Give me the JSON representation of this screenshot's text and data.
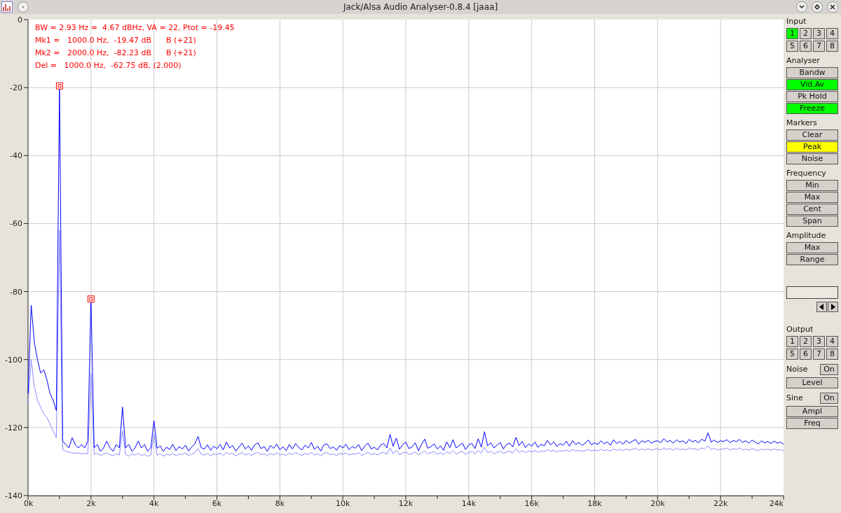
{
  "window": {
    "title": "Jack/Alsa Audio Analyser-0.8.4  [jaaa]"
  },
  "plot": {
    "readout": [
      "BW = 2.93 Hz =  4.67 dBHz, VA = 22, Ptot = -19.45",
      "Mk1 =   1000.0 Hz,  -19.47 dB      B (+21)",
      "Mk2 =   2000.0 Hz,  -82.23 dB      B (+21)",
      "Del =   1000.0 Hz,  -62.75 dB, (2.000)"
    ],
    "chart_data": {
      "type": "line",
      "grid": true,
      "xlim": [
        0,
        24000
      ],
      "ylim": [
        -140,
        0
      ],
      "xticks": [
        {
          "value": 0,
          "label": "0k"
        },
        {
          "value": 2000,
          "label": "2k"
        },
        {
          "value": 4000,
          "label": "4k"
        },
        {
          "value": 6000,
          "label": "6k"
        },
        {
          "value": 8000,
          "label": "8k"
        },
        {
          "value": 10000,
          "label": "10k"
        },
        {
          "value": 12000,
          "label": "12k"
        },
        {
          "value": 14000,
          "label": "14k"
        },
        {
          "value": 16000,
          "label": "16k"
        },
        {
          "value": 18000,
          "label": "18k"
        },
        {
          "value": 20000,
          "label": "20k"
        },
        {
          "value": 22000,
          "label": "22k"
        },
        {
          "value": 24000,
          "label": "24k"
        }
      ],
      "yticks": [
        0,
        -20,
        -40,
        -60,
        -80,
        -100,
        -120,
        -140
      ],
      "x": [
        0,
        100,
        200,
        300,
        400,
        500,
        600,
        700,
        800,
        900,
        1000,
        1100,
        1200,
        1300,
        1400,
        1500,
        1600,
        1700,
        1800,
        1900,
        2000,
        2100,
        2200,
        2300,
        2400,
        2500,
        2600,
        2700,
        2800,
        2900,
        3000,
        3100,
        3200,
        3300,
        3400,
        3500,
        3600,
        3700,
        3800,
        3900,
        4000,
        4100,
        4200,
        4300,
        4400,
        4500,
        4600,
        4700,
        4800,
        4900,
        5000,
        5100,
        5200,
        5300,
        5400,
        5500,
        5600,
        5700,
        5800,
        5900,
        6000,
        6100,
        6200,
        6300,
        6400,
        6500,
        6600,
        6700,
        6800,
        6900,
        7000,
        7100,
        7200,
        7300,
        7400,
        7500,
        7600,
        7700,
        7800,
        7900,
        8000,
        8100,
        8200,
        8300,
        8400,
        8500,
        8600,
        8700,
        8800,
        8900,
        9000,
        9100,
        9200,
        9300,
        9400,
        9500,
        9600,
        9700,
        9800,
        9900,
        10000,
        10100,
        10200,
        10300,
        10400,
        10500,
        10600,
        10700,
        10800,
        10900,
        11000,
        11100,
        11200,
        11300,
        11400,
        11500,
        11600,
        11700,
        11800,
        11900,
        12000,
        12100,
        12200,
        12300,
        12400,
        12500,
        12600,
        12700,
        12800,
        12900,
        13000,
        13100,
        13200,
        13300,
        13400,
        13500,
        13600,
        13700,
        13800,
        13900,
        14000,
        14100,
        14200,
        14300,
        14400,
        14500,
        14600,
        14700,
        14800,
        14900,
        15000,
        15100,
        15200,
        15300,
        15400,
        15500,
        15600,
        15700,
        15800,
        15900,
        16000,
        16100,
        16200,
        16300,
        16400,
        16500,
        16600,
        16700,
        16800,
        16900,
        17000,
        17100,
        17200,
        17300,
        17400,
        17500,
        17600,
        17700,
        17800,
        17900,
        18000,
        18100,
        18200,
        18300,
        18400,
        18500,
        18600,
        18700,
        18800,
        18900,
        19000,
        19100,
        19200,
        19300,
        19400,
        19500,
        19600,
        19700,
        19800,
        19900,
        20000,
        20100,
        20200,
        20300,
        20400,
        20500,
        20600,
        20700,
        20800,
        20900,
        21000,
        21100,
        21200,
        21300,
        21400,
        21500,
        21600,
        21700,
        21800,
        21900,
        22000,
        22100,
        22200,
        22300,
        22400,
        22500,
        22600,
        22700,
        22800,
        22900,
        23000,
        23100,
        23200,
        23300,
        23400,
        23500,
        23600,
        23700,
        23800,
        23900,
        24000
      ],
      "series": [
        {
          "color": "#8a8aff",
          "values": [
            -113,
            -100,
            -108,
            -112,
            -114,
            -116,
            -117,
            -119,
            -121,
            -123,
            -62,
            -126.5,
            -127.0,
            -127.2,
            -127.4,
            -127.6,
            -127.5,
            -127.8,
            -127.6,
            -127.7,
            -104.0,
            -127.9,
            -127.6,
            -128.2,
            -127.8,
            -127.5,
            -128.0,
            -128.3,
            -127.7,
            -128.1,
            -121.0,
            -127.9,
            -128.4,
            -127.8,
            -128.1,
            -127.6,
            -128.3,
            -127.9,
            -128.5,
            -128.0,
            -122.0,
            -128.2,
            -127.7,
            -128.4,
            -127.9,
            -128.1,
            -127.6,
            -128.3,
            -127.8,
            -128.0,
            -127.5,
            -128.2,
            -127.9,
            -127.4,
            -126.2,
            -127.8,
            -128.1,
            -127.6,
            -128.3,
            -127.7,
            -128.0,
            -127.5,
            -128.2,
            -127.3,
            -127.9,
            -127.6,
            -128.3,
            -127.8,
            -127.4,
            -128.1,
            -127.7,
            -128.2,
            -127.6,
            -127.3,
            -128.0,
            -127.7,
            -128.4,
            -127.6,
            -128.1,
            -127.5,
            -128.0,
            -127.8,
            -128.3,
            -127.5,
            -128.0,
            -127.4,
            -127.9,
            -128.2,
            -127.6,
            -128.0,
            -127.3,
            -128.1,
            -127.7,
            -128.3,
            -127.6,
            -127.4,
            -128.0,
            -127.8,
            -128.2,
            -127.6,
            -127.9,
            -127.5,
            -128.1,
            -127.7,
            -127.9,
            -127.4,
            -128.2,
            -127.8,
            -127.3,
            -128.0,
            -127.6,
            -128.1,
            -127.6,
            -127.3,
            -127.9,
            -126.0,
            -127.7,
            -126.7,
            -128.0,
            -127.5,
            -127.2,
            -127.9,
            -127.6,
            -127.2,
            -128.1,
            -127.5,
            -126.9,
            -127.8,
            -127.4,
            -127.1,
            -127.9,
            -127.4,
            -128.0,
            -127.1,
            -127.7,
            -126.8,
            -127.8,
            -127.3,
            -127.0,
            -127.9,
            -127.4,
            -127.0,
            -127.8,
            -126.7,
            -127.6,
            -125.8,
            -127.4,
            -127.0,
            -127.7,
            -127.3,
            -126.9,
            -127.6,
            -127.2,
            -126.9,
            -127.5,
            -126.2,
            -127.3,
            -126.8,
            -127.4,
            -126.9,
            -127.2,
            -126.8,
            -127.3,
            -126.9,
            -127.1,
            -126.5,
            -127.0,
            -126.7,
            -127.2,
            -126.8,
            -127.0,
            -126.6,
            -127.1,
            -126.5,
            -126.9,
            -126.7,
            -127.0,
            -126.8,
            -126.4,
            -126.9,
            -126.6,
            -126.9,
            -126.4,
            -126.8,
            -126.5,
            -126.9,
            -126.3,
            -126.7,
            -126.4,
            -126.8,
            -126.3,
            -126.7,
            -126.4,
            -126.1,
            -126.7,
            -126.3,
            -126.6,
            -126.2,
            -126.7,
            -126.4,
            -126.3,
            -126.6,
            -126.0,
            -126.5,
            -126.2,
            -126.7,
            -126.1,
            -126.5,
            -126.3,
            -126.6,
            -126.0,
            -126.4,
            -126.2,
            -126.6,
            -126.0,
            -126.3,
            -125.4,
            -126.5,
            -126.1,
            -126.6,
            -126.3,
            -126.4,
            -126.0,
            -126.6,
            -126.2,
            -126.5,
            -126.0,
            -126.6,
            -126.3,
            -126.7,
            -126.2,
            -126.5,
            -126.8,
            -126.3,
            -126.6,
            -126.4,
            -126.7,
            -126.3,
            -126.6,
            -126.5,
            -126.8
          ]
        },
        {
          "color": "#0000ff",
          "values": [
            -110,
            -84,
            -95,
            -100,
            -104,
            -103,
            -106,
            -110,
            -112,
            -115,
            -19.5,
            -124,
            -125,
            -126,
            -123,
            -125,
            -126,
            -125,
            -126,
            -124,
            -82.2,
            -126,
            -125,
            -127,
            -126,
            -124,
            -126,
            -127,
            -125,
            -126,
            -114,
            -126,
            -125,
            -127,
            -126,
            -124,
            -126,
            -125,
            -127,
            -126,
            -118,
            -126.1,
            -125.4,
            -127.0,
            -125.8,
            -126.5,
            -124.9,
            -126.8,
            -125.6,
            -126.3,
            -125.2,
            -126.9,
            -125.7,
            -124.8,
            -122.6,
            -125.9,
            -126.4,
            -125.1,
            -126.7,
            -125.5,
            -126.2,
            -125.0,
            -126.6,
            -124.3,
            -126.0,
            -125.3,
            -126.9,
            -125.8,
            -124.6,
            -126.3,
            -125.4,
            -126.7,
            -125.1,
            -124.5,
            -126.2,
            -125.6,
            -127.0,
            -125.3,
            -126.1,
            -124.9,
            -126.5,
            -125.7,
            -126.8,
            -125.0,
            -126.3,
            -124.7,
            -125.9,
            -126.6,
            -125.2,
            -126.0,
            -124.4,
            -126.4,
            -125.5,
            -126.9,
            -125.1,
            -124.8,
            -126.2,
            -125.7,
            -126.7,
            -125.3,
            -126.0,
            -124.9,
            -126.5,
            -125.6,
            -126.1,
            -125.0,
            -126.8,
            -125.4,
            -124.6,
            -126.3,
            -125.8,
            -126.6,
            -125.2,
            -124.7,
            -126.0,
            -122.0,
            -125.5,
            -123.1,
            -126.4,
            -125.1,
            -124.3,
            -126.2,
            -125.7,
            -124.5,
            -126.8,
            -125.0,
            -123.4,
            -126.1,
            -125.6,
            -124.8,
            -126.3,
            -125.4,
            -126.7,
            -124.2,
            -125.9,
            -123.6,
            -126.0,
            -125.3,
            -124.6,
            -126.5,
            -125.1,
            -124.7,
            -126.2,
            -123.3,
            -125.8,
            -121.2,
            -125.4,
            -124.5,
            -126.0,
            -125.2,
            -124.4,
            -126.3,
            -125.0,
            -124.6,
            -125.7,
            -122.9,
            -125.3,
            -124.1,
            -125.9,
            -124.8,
            -125.5,
            -124.3,
            -125.8,
            -124.9,
            -125.4,
            -123.8,
            -125.1,
            -124.2,
            -125.6,
            -124.7,
            -125.2,
            -124.0,
            -125.5,
            -123.9,
            -125.0,
            -124.4,
            -125.3,
            -124.6,
            -123.7,
            -125.1,
            -124.5,
            -125.0,
            -123.9,
            -124.8,
            -124.2,
            -125.2,
            -123.6,
            -124.7,
            -124.1,
            -124.9,
            -123.8,
            -124.6,
            -124.0,
            -123.5,
            -124.9,
            -123.9,
            -124.4,
            -123.7,
            -124.6,
            -124.1,
            -123.9,
            -124.5,
            -123.3,
            -124.2,
            -123.8,
            -124.6,
            -123.6,
            -124.3,
            -123.9,
            -124.7,
            -123.5,
            -124.2,
            -123.8,
            -124.5,
            -123.4,
            -124.0,
            -121.6,
            -124.3,
            -123.7,
            -124.4,
            -123.9,
            -124.1,
            -123.6,
            -124.5,
            -123.8,
            -124.2,
            -123.5,
            -124.4,
            -123.9,
            -124.6,
            -123.7,
            -124.3,
            -124.8,
            -123.9,
            -124.5,
            -124.1,
            -124.7,
            -124.0,
            -124.6,
            -124.3,
            -124.9
          ]
        }
      ]
    }
  },
  "panel": [
    {
      "kind": "grid",
      "title": "Input",
      "buttons": [
        {
          "label": "1",
          "on": true,
          "color": "#00ff00"
        },
        {
          "label": "2",
          "on": false
        },
        {
          "label": "3",
          "on": false
        },
        {
          "label": "4",
          "on": false
        },
        {
          "label": "5",
          "on": false
        },
        {
          "label": "6",
          "on": false
        },
        {
          "label": "7",
          "on": false
        },
        {
          "label": "8",
          "on": false
        }
      ]
    },
    {
      "kind": "list",
      "title": "Analyser",
      "buttons": [
        {
          "label": "Bandw",
          "on": false
        },
        {
          "label": "Vid.Av",
          "on": true,
          "color": "#00ff00"
        },
        {
          "label": "Pk Hold",
          "on": false
        },
        {
          "label": "Freeze",
          "on": true,
          "color": "#00ff00"
        }
      ]
    },
    {
      "kind": "list",
      "title": "Markers",
      "buttons": [
        {
          "label": "Clear",
          "on": false
        },
        {
          "label": "Peak",
          "on": true,
          "color": "#ffff00"
        },
        {
          "label": "Noise",
          "on": false
        }
      ]
    },
    {
      "kind": "list",
      "title": "Frequency",
      "buttons": [
        {
          "label": "Min",
          "on": false
        },
        {
          "label": "Max",
          "on": false
        },
        {
          "label": "Cent",
          "on": false
        },
        {
          "label": "Span",
          "on": false
        }
      ]
    },
    {
      "kind": "list",
      "title": "Amplitude",
      "buttons": [
        {
          "label": "Max",
          "on": false
        },
        {
          "label": "Range",
          "on": false
        }
      ]
    },
    {
      "kind": "entry"
    },
    {
      "kind": "grid",
      "title": "Output",
      "buttons": [
        {
          "label": "1",
          "on": false
        },
        {
          "label": "2",
          "on": false
        },
        {
          "label": "3",
          "on": false
        },
        {
          "label": "4",
          "on": false
        },
        {
          "label": "5",
          "on": false
        },
        {
          "label": "6",
          "on": false
        },
        {
          "label": "7",
          "on": false
        },
        {
          "label": "8",
          "on": false
        }
      ]
    },
    {
      "kind": "toggle",
      "title": "Noise",
      "toggle": {
        "label": "On",
        "on": false
      },
      "buttons": [
        {
          "label": "Level",
          "on": false
        }
      ]
    },
    {
      "kind": "toggle",
      "title": "Sine",
      "toggle": {
        "label": "On",
        "on": false
      },
      "buttons": [
        {
          "label": "Ampl",
          "on": false
        },
        {
          "label": "Freq",
          "on": false
        }
      ]
    }
  ]
}
